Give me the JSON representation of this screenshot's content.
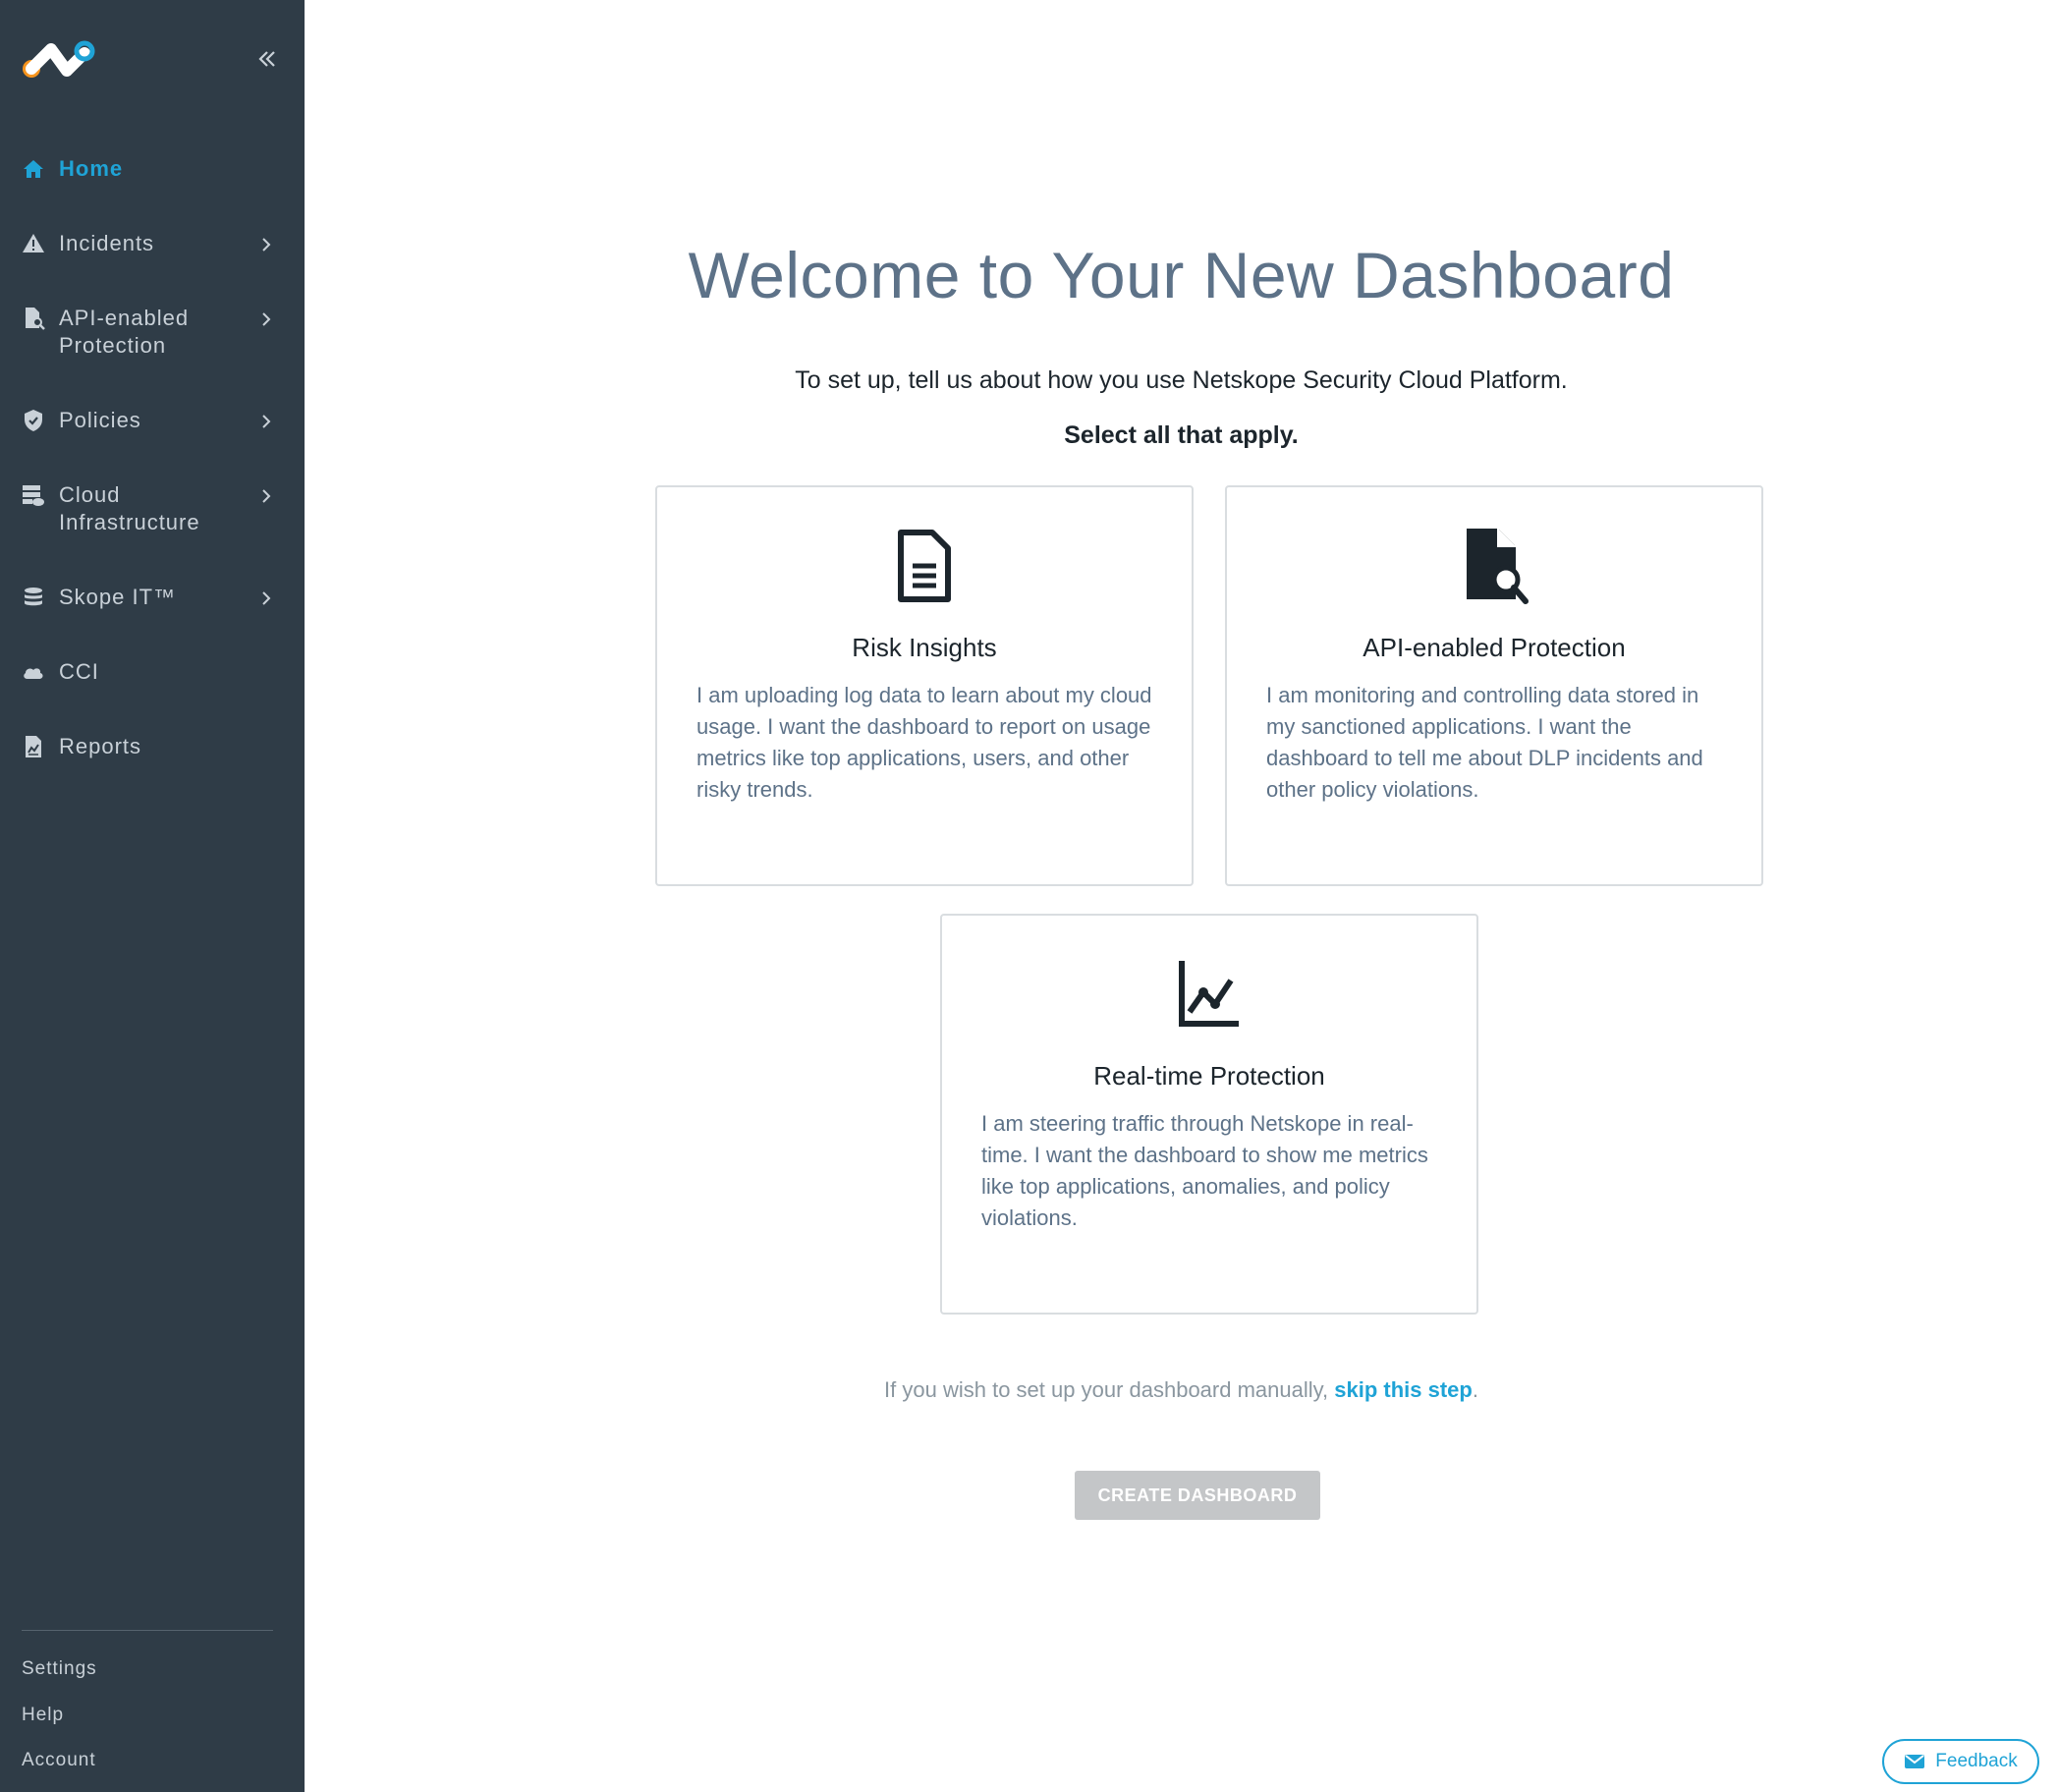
{
  "sidebar": {
    "items": [
      {
        "label": "Home",
        "icon": "home-icon",
        "active": true
      },
      {
        "label": "Incidents",
        "icon": "warning-icon"
      },
      {
        "label": "API-enabled Protection",
        "icon": "document-search-icon"
      },
      {
        "label": "Policies",
        "icon": "shield-icon"
      },
      {
        "label": "Cloud Infrastructure",
        "icon": "cloud-infrastructure-icon"
      },
      {
        "label": "Skope IT™",
        "icon": "database-icon"
      },
      {
        "label": "CCI",
        "icon": "cloud-icon"
      },
      {
        "label": "Reports",
        "icon": "report-icon"
      }
    ],
    "footer": {
      "settings": "Settings",
      "help": "Help",
      "account": "Account"
    }
  },
  "main": {
    "title": "Welcome to Your New Dashboard",
    "subtitle": "To set up, tell us about how you use Netskope Security Cloud Platform.",
    "instruction": "Select all that apply.",
    "cards": [
      {
        "title": "Risk Insights",
        "icon": "document-icon",
        "description": "I am uploading log data to learn about my cloud usage. I want the dashboard to report on usage metrics like top applications, users, and other risky trends."
      },
      {
        "title": "API-enabled Protection",
        "icon": "document-search-icon",
        "description": "I am monitoring and controlling data stored in my sanctioned applications. I want the dashboard to tell me about DLP incidents and other policy violations."
      },
      {
        "title": "Real-time Protection",
        "icon": "line-chart-icon",
        "description": "I am steering traffic through Netskope in real-time. I want the dashboard to show me metrics like top applications, anomalies, and policy violations."
      }
    ],
    "skip_prefix": "If you wish to set up your dashboard manually, ",
    "skip_link": "skip this step",
    "skip_suffix": ".",
    "create_button": "CREATE DASHBOARD"
  },
  "feedback": {
    "label": "Feedback",
    "icon": "mail-icon"
  },
  "colors": {
    "sidebar_bg": "#2f3c47",
    "accent": "#1fa3d6",
    "title": "#5d7288",
    "button_disabled": "#c4c6c8",
    "logo_orange": "#f7941d"
  }
}
